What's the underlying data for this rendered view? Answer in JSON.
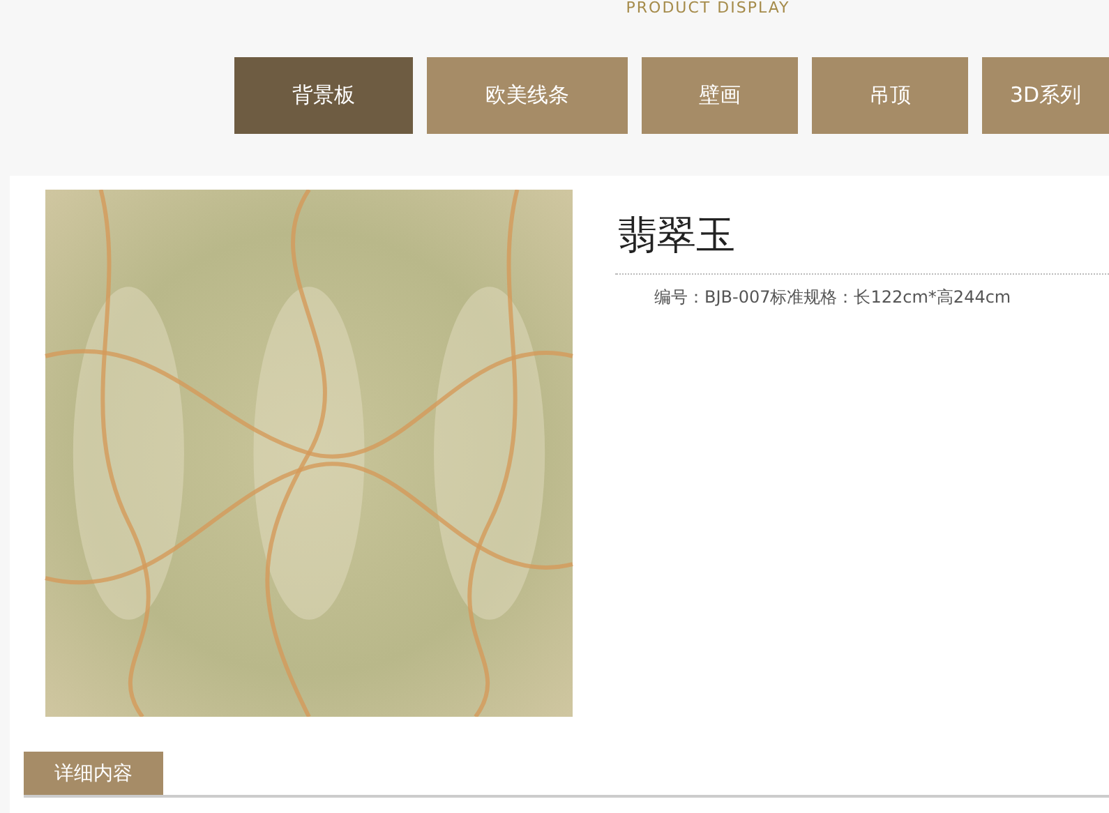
{
  "header": {
    "subtitle": "PRODUCT DISPLAY"
  },
  "tabs": [
    {
      "label": "背景板",
      "selected": true
    },
    {
      "label": "欧美线条",
      "selected": false
    },
    {
      "label": "壁画",
      "selected": false
    },
    {
      "label": "吊顶",
      "selected": false
    },
    {
      "label": "3D系列",
      "selected": false
    }
  ],
  "product": {
    "title": "翡翠玉",
    "spec": "编号：BJB-007标准规格：长122cm*高244cm"
  },
  "detail_tabs": [
    {
      "label": "详细内容",
      "selected": true
    }
  ]
}
